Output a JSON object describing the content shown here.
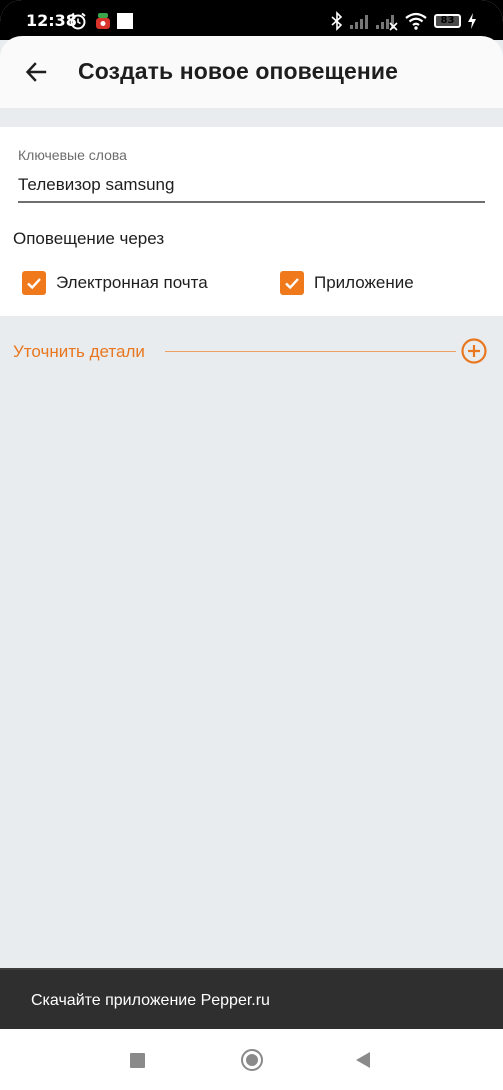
{
  "status_bar": {
    "time": "12:38",
    "battery": "83",
    "battery_level": 0.83
  },
  "header": {
    "title": "Создать новое оповещение",
    "back_icon": "arrow-left-icon"
  },
  "form": {
    "keywords_label": "Ключевые слова",
    "keywords_value": "Телевизор samsung",
    "notify_via_label": "Оповещение через",
    "options": [
      {
        "label": "Электронная почта",
        "checked": true
      },
      {
        "label": "Приложение",
        "checked": true
      }
    ]
  },
  "details": {
    "label": "Уточнить детали",
    "add_icon": "plus-circle-icon"
  },
  "banner": {
    "text": "Скачайте приложение Pepper.ru"
  },
  "colors": {
    "accent": "#f0791c",
    "background": "#e9ecef",
    "banner": "#2f2f2f"
  }
}
